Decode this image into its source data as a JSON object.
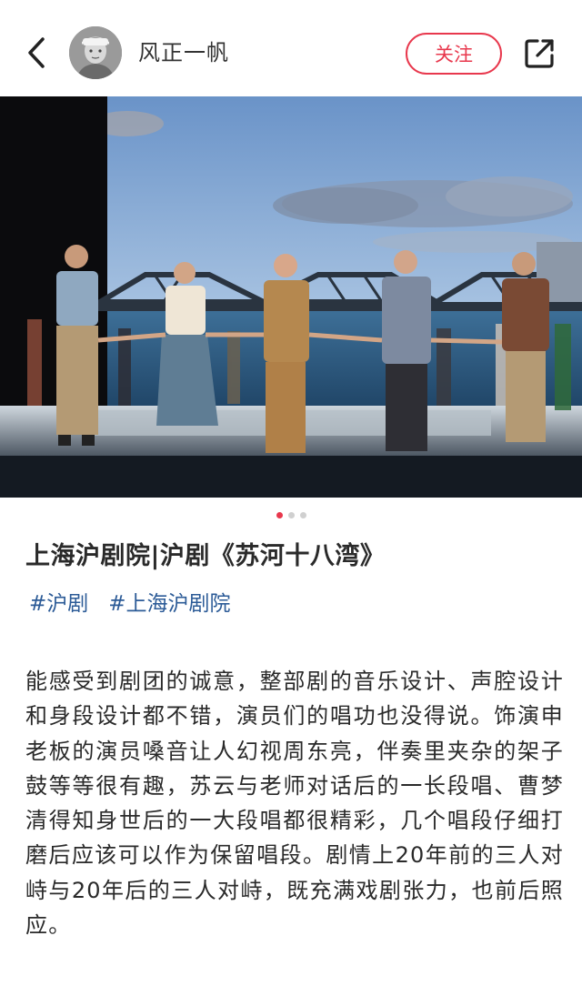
{
  "header": {
    "username": "风正一帆",
    "follow_label": "关注"
  },
  "gallery": {
    "photo_description_icon": "stage-curtain-call-photo",
    "page_count": 3,
    "active_index": 0
  },
  "post": {
    "title": "上海沪剧院|沪剧《苏河十八湾》",
    "tags": [
      "#沪剧",
      "#上海沪剧院"
    ],
    "body": "能感受到剧团的诚意，整部剧的音乐设计、声腔设计和身段设计都不错，演员们的唱功也没得说。饰演申老板的演员嗓音让人幻视周东亮，伴奏里夹杂的架子鼓等等很有趣，苏云与老师对话后的一长段唱、曹梦清得知身世后的一大段唱都很精彩，几个唱段仔细打磨后应该可以作为保留唱段。剧情上20年前的三人对峙与20年后的三人对峙，既充满戏剧张力，也前后照应。"
  },
  "colors": {
    "accent": "#e8384d",
    "tag": "#2c5b97"
  }
}
